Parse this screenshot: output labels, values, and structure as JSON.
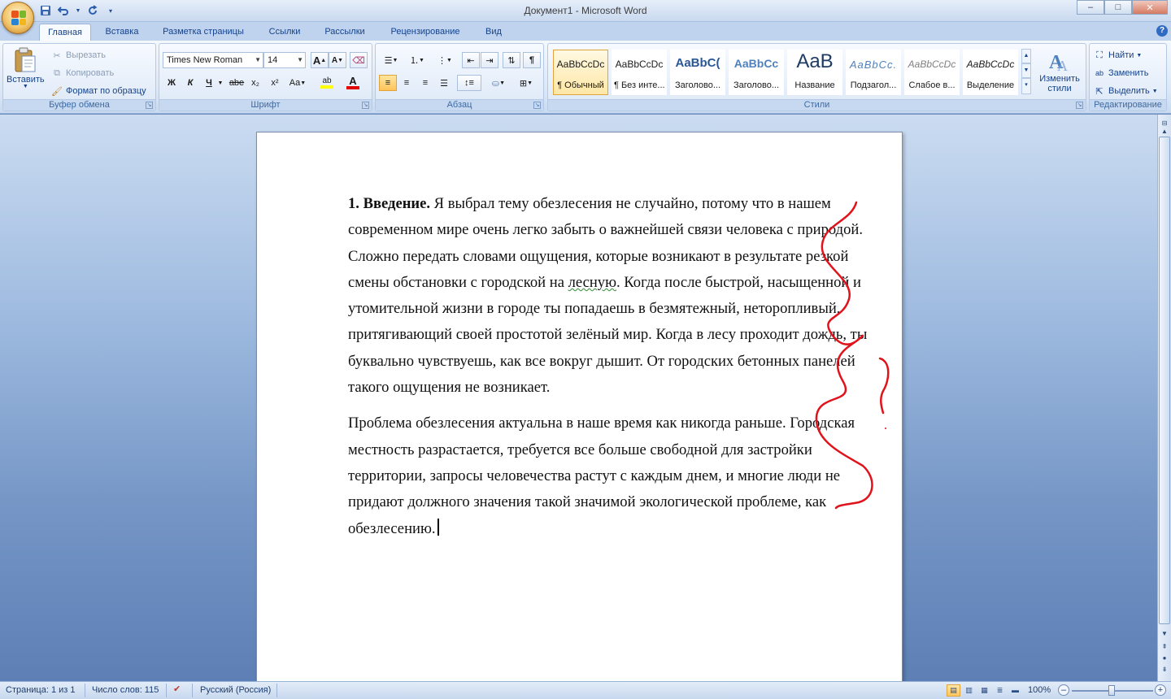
{
  "window": {
    "title": "Документ1 - Microsoft Word",
    "buttons": {
      "minimize": "–",
      "maximize": "□",
      "close": "✕"
    }
  },
  "qat": {
    "save_icon": "save-icon",
    "undo_icon": "undo-icon",
    "redo_icon": "repeat-icon",
    "customize_icon": "chevron-down-icon"
  },
  "tabs": [
    "Главная",
    "Вставка",
    "Разметка страницы",
    "Ссылки",
    "Рассылки",
    "Рецензирование",
    "Вид"
  ],
  "ribbon": {
    "clipboard": {
      "label": "Буфер обмена",
      "paste": "Вставить",
      "cut": "Вырезать",
      "copy": "Копировать",
      "format_painter": "Формат по образцу"
    },
    "font": {
      "label": "Шрифт",
      "font_name": "Times New Roman",
      "font_size": "14",
      "grow": "A",
      "shrink": "A",
      "bold": "Ж",
      "italic": "К",
      "underline": "Ч",
      "strike": "abe",
      "subscript": "x₂",
      "superscript": "x²",
      "change_case": "Aa",
      "highlight": "ab",
      "font_color": "A",
      "highlight_color": "#ffff00",
      "font_color_value": "#e00000"
    },
    "paragraph": {
      "label": "Абзац"
    },
    "styles": {
      "label": "Стили",
      "items": [
        {
          "sample": "AaBbCcDc",
          "name": "¶ Обычный"
        },
        {
          "sample": "AaBbCcDc",
          "name": "¶ Без инте..."
        },
        {
          "sample": "AaBbC(",
          "name": "Заголово..."
        },
        {
          "sample": "AaBbCc",
          "name": "Заголово..."
        },
        {
          "sample": "AaB",
          "name": "Название"
        },
        {
          "sample": "AaBbCc.",
          "name": "Подзагол..."
        },
        {
          "sample": "AaBbCcDc",
          "name": "Слабое в..."
        },
        {
          "sample": "AaBbCcDc",
          "name": "Выделение"
        }
      ],
      "change_styles": "Изменить стили"
    },
    "editing": {
      "label": "Редактирование",
      "find": "Найти",
      "replace": "Заменить",
      "select": "Выделить"
    }
  },
  "document": {
    "heading": "1. Введение.",
    "p1_a": " Я выбрал тему обезлесения не случайно, потому что в нашем современном мире очень легко забыть о важнейшей связи человека с природой. Сложно передать словами ощущения, которые возникают в результате резкой смены обстановки с городской на ",
    "p1_misspelled": "лесную",
    "p1_b": ". Когда после быстрой, насыщенной и утомительной жизни в городе ты попадаешь в безмятежный, неторопливый, притягивающий своей простотой зелёный мир. Когда в лесу проходит дождь, ты буквально чувствуешь, как все вокруг дышит. От городских бетонных панелей такого ощущения не возникает.",
    "p2": "Проблема обезлесения актуальна в наше время как никогда раньше. Городская местность разрастается, требуется все больше свободной для застройки территории, запросы человечества растут с каждым днем, и многие люди не придают должного значения такой значимой экологической проблеме, как обезлесению."
  },
  "statusbar": {
    "page": "Страница: 1 из 1",
    "words": "Число слов: 115",
    "language": "Русский (Россия)",
    "zoom": "100%",
    "zoom_percent": 100
  }
}
